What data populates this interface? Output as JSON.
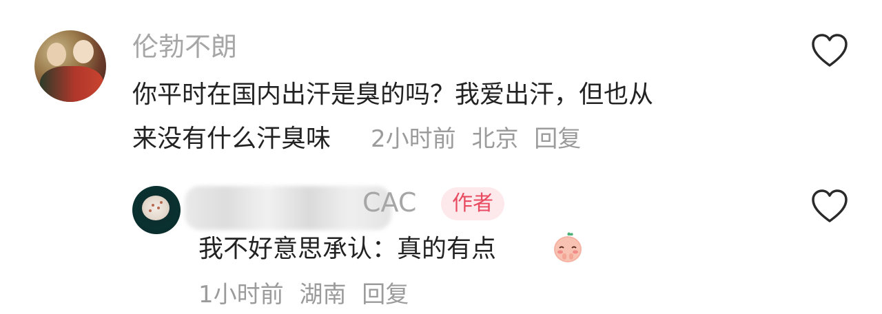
{
  "comments": [
    {
      "username": "伦勃不朗",
      "text_line1": "你平时在国内出汗是臭的吗？我爱出汗，但也从",
      "text_line2": "来没有什么汗臭味",
      "time": "2小时前",
      "location": "北京",
      "reply_label": "回复",
      "avatar_icon": "portrait-avatar"
    },
    {
      "username": "CAC",
      "author_badge": "作者",
      "text": "我不好意思承认：真的有点",
      "time": "1小时前",
      "location": "湖南",
      "reply_label": "回复",
      "avatar_icon": "coffee-cup-avatar",
      "emoji_icon": "shy-face-emoji"
    }
  ],
  "colors": {
    "username": "#a6a6a6",
    "text": "#222222",
    "meta": "#9b9b9b",
    "badge_bg": "#fde8ec",
    "badge_text": "#e84a5f",
    "like_stroke": "#2a2a2a"
  },
  "icons": {
    "like": "heart-outline-icon"
  }
}
